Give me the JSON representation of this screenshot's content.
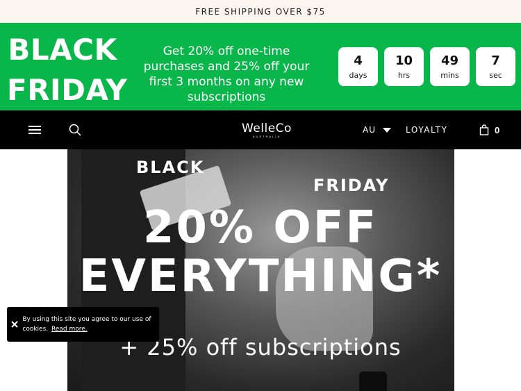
{
  "announcement": {
    "text": "FREE SHIPPING OVER $75"
  },
  "promo": {
    "title_line1": "BLACK",
    "title_line2": "FRIDAY",
    "description": "Get 20% off one-time purchases and 25% off your first 3 months on any new subscriptions",
    "countdown": [
      {
        "value": "4",
        "unit": "days"
      },
      {
        "value": "10",
        "unit": "hrs"
      },
      {
        "value": "49",
        "unit": "mins"
      },
      {
        "value": "7",
        "unit": "sec"
      }
    ],
    "background_color": "#08b64a"
  },
  "nav": {
    "logo": "WelleCo",
    "logo_sub": "AUSTRALIA",
    "region": "AU",
    "loyalty": "LOYALTY",
    "cart_count": "0",
    "icons": [
      "menu-icon",
      "search-icon",
      "caret-down-icon",
      "bag-icon"
    ]
  },
  "hero": {
    "line_black": "BLACK",
    "line_friday": "FRIDAY",
    "headline1": "20% OFF",
    "headline2": "EVERYTHING*",
    "subline": "+ 25% off subscriptions"
  },
  "cookie": {
    "text": "By using this site you agree to our use of cookies.",
    "link": "Read more."
  }
}
